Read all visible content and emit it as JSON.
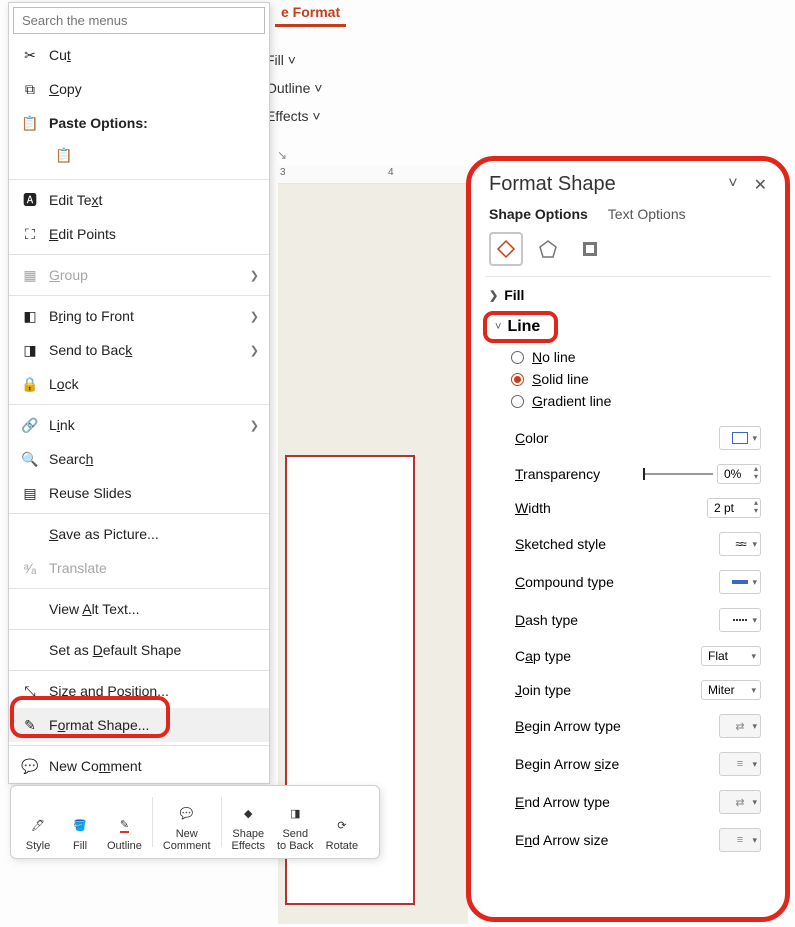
{
  "ribbon": {
    "tab": "e Format",
    "items": {
      "fill": "Fill ˅",
      "outline": "Outline ˅",
      "effects": "Effects ˅"
    }
  },
  "ruler": {
    "mark3": "3",
    "mark4": "4"
  },
  "context_menu": {
    "search_placeholder": "Search the menus",
    "cut": "Cut",
    "copy": "Copy",
    "paste_options": "Paste Options:",
    "edit_text": "Edit Text",
    "edit_points": "Edit Points",
    "group": "Group",
    "bring_front": "Bring to Front",
    "send_back": "Send to Back",
    "lock": "Lock",
    "link": "Link",
    "search": "Search",
    "reuse_slides": "Reuse Slides",
    "save_picture": "Save as Picture...",
    "translate": "Translate",
    "alt_text": "View Alt Text...",
    "default_shape": "Set as Default Shape",
    "size_pos": "Size and Position...",
    "format_shape": "Format Shape...",
    "new_comment": "New Comment"
  },
  "mini_toolbar": {
    "style": "Style",
    "fill": "Fill",
    "outline": "Outline",
    "new_comment_l1": "New",
    "new_comment_l2": "Comment",
    "shape_effects_l1": "Shape",
    "shape_effects_l2": "Effects",
    "send_back_l1": "Send",
    "send_back_l2": "to Back",
    "rotate": "Rotate"
  },
  "pane": {
    "title": "Format Shape",
    "tabs": {
      "shape": "Shape Options",
      "text": "Text Options"
    },
    "fill_head": "Fill",
    "line_head": "Line",
    "line_opts": {
      "no_line": "No line",
      "solid": "Solid line",
      "gradient": "Gradient line"
    },
    "props": {
      "color": "Color",
      "transparency": "Transparency",
      "transparency_val": "0%",
      "width": "Width",
      "width_val": "2 pt",
      "sketched": "Sketched style",
      "compound": "Compound type",
      "dash": "Dash type",
      "cap": "Cap type",
      "cap_val": "Flat",
      "join": "Join type",
      "join_val": "Miter",
      "begin_arrow_type": "Begin Arrow type",
      "begin_arrow_size": "Begin Arrow size",
      "end_arrow_type": "End Arrow type",
      "end_arrow_size": "End Arrow size"
    }
  }
}
